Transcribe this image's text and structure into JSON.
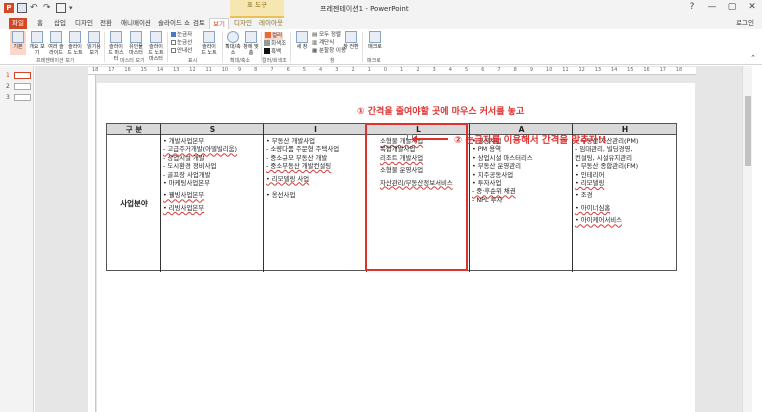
{
  "window": {
    "title": "프레젠테이션1 - PowerPoint",
    "app_logo": "P",
    "context_tab_group": "표 도구",
    "controls": [
      "?",
      "—",
      "▢",
      "✕"
    ],
    "login": "로그인"
  },
  "tabs": [
    "파일",
    "홈",
    "삽입",
    "디자인",
    "전환",
    "애니메이션",
    "슬라이드 쇼",
    "검토",
    "보기",
    "디자인",
    "레이아웃"
  ],
  "ribbon": {
    "view_buttons": [
      "기본",
      "개요 보기",
      "여러 슬라이드",
      "슬라이드 노트",
      "읽기용 보기"
    ],
    "master_buttons": [
      "슬라이드 마스터",
      "유인물 마스터",
      "슬라이드 노트 마스터"
    ],
    "show_checks": [
      "눈금자",
      "눈금선",
      "안내선"
    ],
    "notes_button": "슬라이드 노트",
    "zoom_buttons": [
      "확대/축소",
      "창에 맞춤"
    ],
    "color_options": [
      "컬러",
      "회색조",
      "흑백"
    ],
    "window_buttons": [
      "새 창"
    ],
    "window_small": [
      "모두 정렬",
      "계단식",
      "분할창 이동"
    ],
    "switch_window": "창 전환",
    "macro": "매크로",
    "group_labels": [
      "프레젠테이션 보기",
      "마스터 보기",
      "표시",
      "확대/축소",
      "컬러/회색조",
      "창",
      "매크로"
    ]
  },
  "thumbnails": [
    "1",
    "2",
    "3"
  ],
  "ruler_ticks": [
    "18",
    "17",
    "16",
    "15",
    "14",
    "13",
    "12",
    "11",
    "10",
    "9",
    "8",
    "7",
    "6",
    "5",
    "4",
    "3",
    "2",
    "1",
    "0",
    "1",
    "2",
    "3",
    "4",
    "5",
    "6",
    "7",
    "8",
    "9",
    "10",
    "11",
    "12",
    "13",
    "14",
    "15",
    "16",
    "17",
    "18"
  ],
  "annotations": {
    "step1": "① 간격을 줄여야할 곳에 마우스 커서를 놓고",
    "step2": "② 눈금자를 이용해서 간격을 맞추자!!"
  },
  "table": {
    "header": [
      "구 분",
      "S",
      "I",
      "L",
      "A",
      "H"
    ],
    "row_label": "사업분야",
    "columns": [
      [
        "• 개발사업본부",
        "- 고급주거개발(아델빌리움)",
        "- 상업시설 개발",
        "- 도시환경 정비사업",
        "- 골프장 사업개발",
        "• 마케팅사업본부",
        "",
        "• 웰빙사업본부",
        "",
        "• 리빙사업본부"
      ],
      [
        "• 부동산 개발사업",
        "- 소량다품 주문형 주택사업",
        "- 중소규모 부동산 개발",
        "- 중소부동산 개발컨설팅",
        "",
        "• 리모델링 사업",
        "",
        "",
        "• 옹선사업"
      ],
      [
        "소형물 개발사업",
        "복합개발사업",
        "리조트 개발사업",
        "",
        "소형물 운영사업",
        "",
        "자산관리/부동산정보서비스"
      ],
      [
        "• 경공사업",
        "• PM 용역",
        "• 상업시설 마스터리스",
        "• 부동산 운영관리",
        "• 지주공동사업",
        "• 투자사업",
        "- 중·후순위 채권",
        "- NPL 투자"
      ],
      [
        "• 부동산 자산관리(PM)",
        "- 임대관리, 빌딩경영,",
        "  컨설팅, 시설유지관리",
        "• 부동산 종합관리(FM)",
        "• 인테리어",
        "• 리모델링",
        "",
        "• 조경",
        "",
        "• 아이너심홈",
        "",
        "• 아이케어서비스"
      ]
    ]
  }
}
